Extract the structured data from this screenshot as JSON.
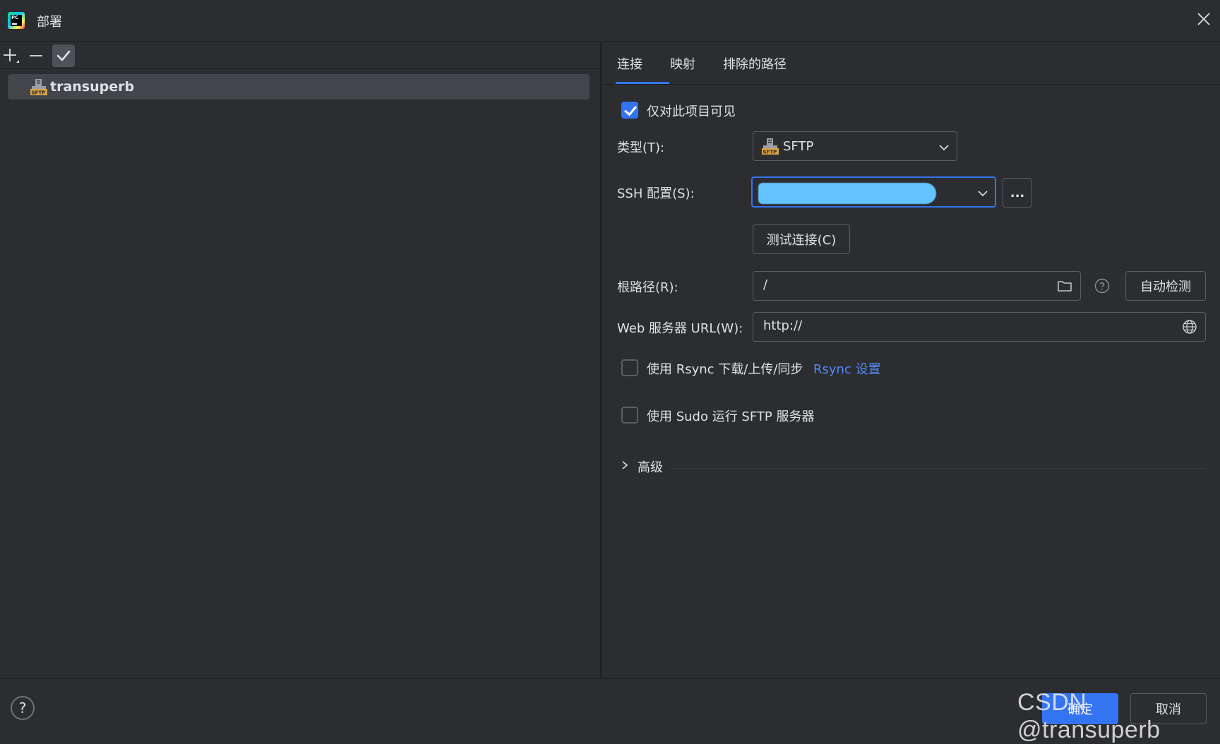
{
  "window": {
    "title": "部署",
    "logo_text": "PC"
  },
  "left": {
    "toolbar": {
      "add_icon": "plus-icon",
      "remove_icon": "minus-icon",
      "default_icon": "check-icon"
    },
    "servers": [
      {
        "name": "transuperb",
        "icon": "sftp-icon",
        "selected": true
      }
    ]
  },
  "tabs": [
    {
      "label": "连接",
      "active": true
    },
    {
      "label": "映射",
      "active": false
    },
    {
      "label": "排除的路径",
      "active": false
    }
  ],
  "form": {
    "visible_only": {
      "label": "仅对此项目可见",
      "checked": true
    },
    "type": {
      "label": "类型(T):",
      "value": "SFTP"
    },
    "ssh": {
      "label": "SSH 配置(S):",
      "value": "",
      "more_label": "..."
    },
    "test_button": "测试连接(C)",
    "root": {
      "label": "根路径(R):",
      "value": "/",
      "autodetect_label": "自动检测"
    },
    "web_url": {
      "label": "Web 服务器 URL(W):",
      "value": "http://"
    },
    "rsync": {
      "label": "使用 Rsync 下载/上传/同步",
      "link": "Rsync 设置",
      "checked": false
    },
    "sudo": {
      "label": "使用 Sudo 运行 SFTP 服务器",
      "checked": false
    },
    "advanced": {
      "label": "高级",
      "expanded": false
    }
  },
  "footer": {
    "help_label": "?",
    "ok_label": "确定",
    "cancel_label": "取消",
    "watermark": "CSDN @transuperb"
  },
  "colors": {
    "background": "#2b2d30",
    "accent": "#3574f0",
    "link": "#548af7",
    "redaction": "#62c3ff"
  }
}
